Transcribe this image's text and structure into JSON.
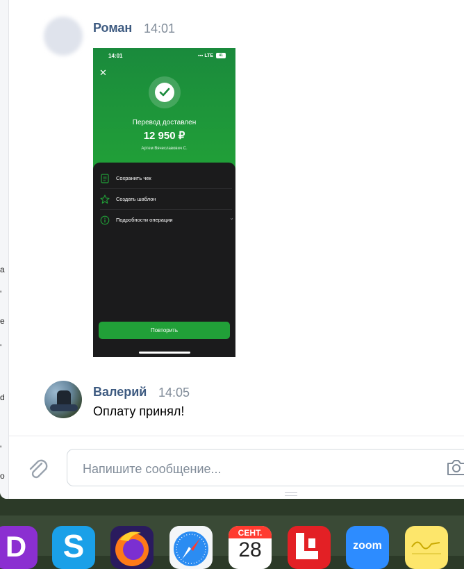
{
  "left_strip_chars": [
    "a",
    "'",
    "e",
    "'",
    "d",
    "'",
    "o"
  ],
  "messages": [
    {
      "author": "Роман",
      "time": "14:01",
      "attachment": {
        "status_time": "14:01",
        "network": "LTE",
        "battery": "41",
        "title": "Перевод доставлен",
        "amount": "12 950 ₽",
        "recipient": "Артем Вячеславович С.",
        "actions": [
          "Сохранить чек",
          "Создать шаблон",
          "Подробности операции"
        ],
        "button": "Повторить"
      }
    },
    {
      "author": "Валерий",
      "time": "14:05",
      "text": "Оплату принял!"
    }
  ],
  "composer": {
    "placeholder": "Напишите сообщение..."
  },
  "dock": {
    "calendar_month": "СЕНТ.",
    "calendar_day": "28",
    "zoom_label": "zoom",
    "items": [
      "podcast-app",
      "skype",
      "firefox",
      "safari",
      "calendar",
      "letterboxd-app",
      "zoom",
      "notes"
    ]
  },
  "colors": {
    "author": "#3d5a80",
    "time": "#818c99",
    "sber_green": "#21a038"
  }
}
